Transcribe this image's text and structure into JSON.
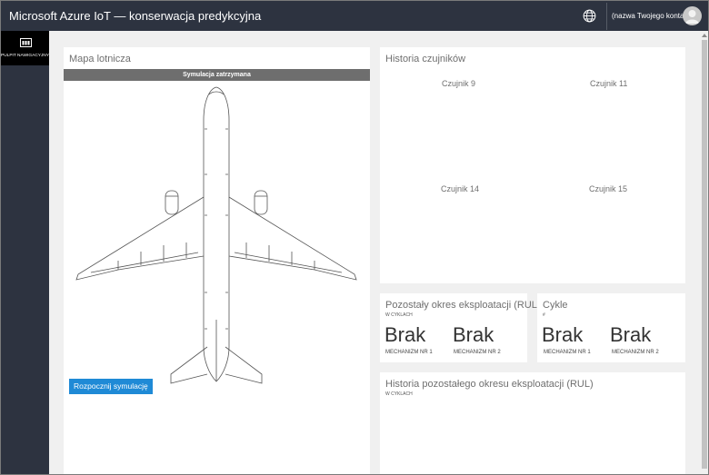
{
  "header": {
    "title": "Microsoft Azure IoT — konserwacja predykcyjna",
    "account_label": "(nazwa Twojego konta)",
    "globe_icon": "globe-icon",
    "avatar_icon": "user-avatar-icon"
  },
  "sidebar": {
    "items": [
      {
        "label": "PULPIT NAWIGACYJNY",
        "icon": "dashboard-icon"
      }
    ]
  },
  "map": {
    "title": "Mapa lotnicza",
    "status": "Symulacja zatrzymana",
    "start_button": "Rozpocznij symulację"
  },
  "sensor_history": {
    "title": "Historia czujników",
    "sensors": [
      "Czujnik 9",
      "Czujnik 11",
      "Czujnik 14",
      "Czujnik 15"
    ]
  },
  "rul": {
    "title": "Pozostały okres eksploatacji (RUL)",
    "subtitle": "W CYKLACH",
    "values": [
      {
        "value": "Brak",
        "label": "MECHANIZM NR 1"
      },
      {
        "value": "Brak",
        "label": "MECHANIZM NR 2"
      }
    ]
  },
  "cycles": {
    "title": "Cykle",
    "subtitle": "#",
    "values": [
      {
        "value": "Brak",
        "label": "MECHANIZM NR 1"
      },
      {
        "value": "Brak",
        "label": "MECHANIZM NR 2"
      }
    ]
  },
  "rul_history": {
    "title": "Historia pozostałego okresu eksploatacji (RUL)",
    "subtitle": "W CYKLACH"
  },
  "colors": {
    "header_bg": "#2d3340",
    "accent": "#1f8ad6",
    "status_bar": "#6e6e6e"
  }
}
